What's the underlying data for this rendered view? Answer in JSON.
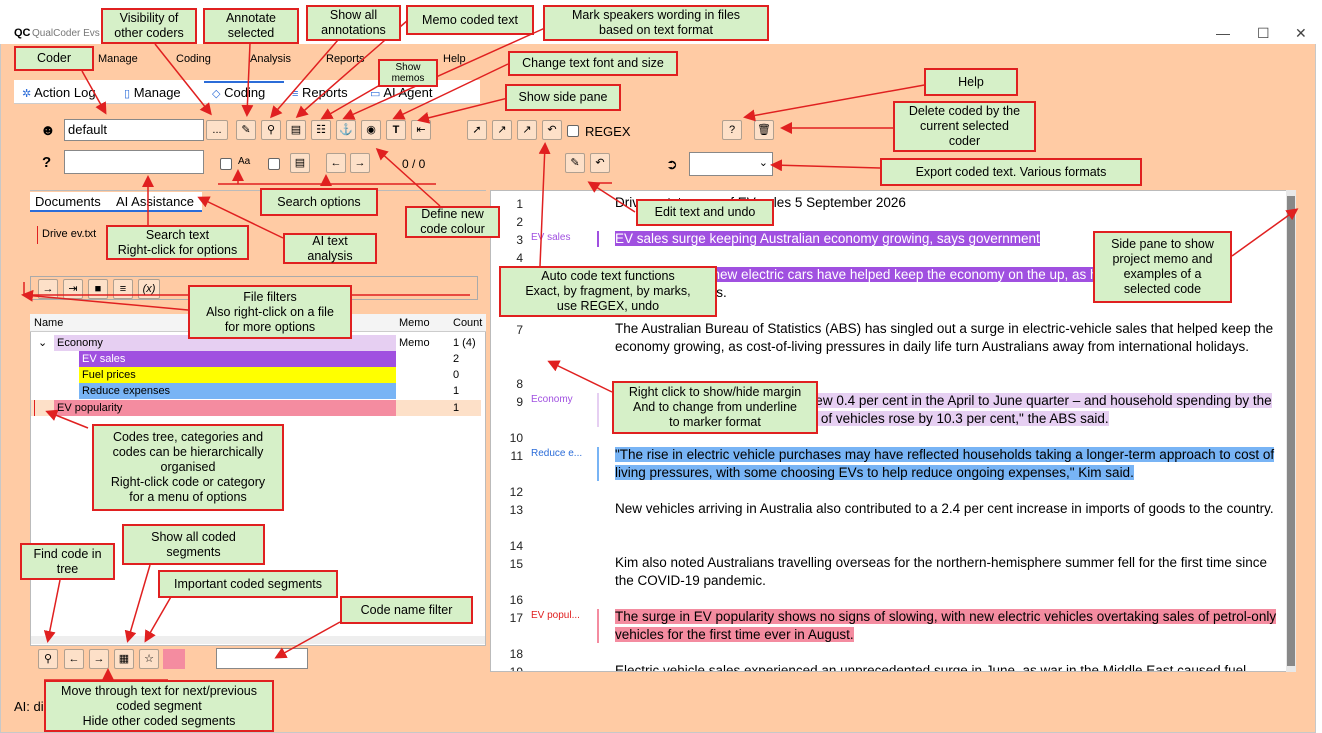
{
  "window": {
    "title": "QualCoder Evs",
    "logo": "QC",
    "controls": [
      "—",
      "☐",
      "✕"
    ]
  },
  "menu": [
    "Manage",
    "Coding",
    "Analysis",
    "Reports",
    "Help"
  ],
  "tabs": [
    {
      "label": "Action Log",
      "icon": "gear-icon"
    },
    {
      "label": "Manage",
      "icon": "document-icon"
    },
    {
      "label": "Coding",
      "icon": "tag-icon"
    },
    {
      "label": "Reports",
      "icon": "list-icon"
    },
    {
      "label": "AI Agent",
      "icon": "chat-icon"
    }
  ],
  "toolbar": {
    "coder_value": "default",
    "more_button": "...",
    "regex_label": "REGEX",
    "help_button": "?",
    "search_counter": "0 / 0",
    "search_case_label": "Aa",
    "search_placeholder": ""
  },
  "left_tabs": [
    "Documents",
    "AI Assistance"
  ],
  "file_list": [
    "Drive ev.txt"
  ],
  "file_filter_buttons": [
    "→",
    "⇥",
    "■",
    "≡",
    "(x)"
  ],
  "code_tree": {
    "headers": [
      "Name",
      "Memo",
      "Count"
    ],
    "rows": [
      {
        "name": "Economy",
        "memo": "Memo",
        "count": "1 (4)",
        "color": "#e6cff2",
        "level": 0,
        "expanded": true
      },
      {
        "name": "EV sales",
        "memo": "",
        "count": "2",
        "color": "#a050e0",
        "level": 1
      },
      {
        "name": "Fuel prices",
        "memo": "",
        "count": "0",
        "color": "#ffff00",
        "level": 1
      },
      {
        "name": "Reduce expenses",
        "memo": "",
        "count": "1",
        "color": "#78b4f5",
        "level": 1
      },
      {
        "name": "EV popularity",
        "memo": "",
        "count": "1",
        "color": "#f48ca0",
        "level": 0
      }
    ]
  },
  "status_bar": "AI: di",
  "document": {
    "lines": [
      {
        "n": "1",
        "text": "Drive ev.txt surge of EV sales 5 September 2026",
        "style": ""
      },
      {
        "n": "2",
        "text": "",
        "style": ""
      },
      {
        "n": "3",
        "text": "EV sales surge keeping Australian economy growing, says government",
        "style": "purple",
        "margin": "EV sales"
      },
      {
        "n": "4",
        "text": "Record sales of new electric cars have helped keep the economy on the up, as households cut back on",
        "style": "purple-partial"
      },
      {
        "n": "5",
        "text": "overseas holidays.",
        "style": ""
      },
      {
        "n": "7",
        "text": "The Australian Bureau of Statistics (ABS) has singled out a surge in electric-vehicle sales that helped keep the economy growing, as cost-of-living pressures in daily life turn Australians away from international holidays.",
        "style": ""
      },
      {
        "n": "8",
        "text": "",
        "style": ""
      },
      {
        "n": "9",
        "text": "Gross domestic product (GDP) grew 0.4 per cent in the April to June quarter – and household spending by the same amount – but the \"purchase of vehicles rose by 10.3 per cent,\" the ABS said.",
        "style": "violet",
        "margin": "Economy"
      },
      {
        "n": "10",
        "text": "",
        "style": ""
      },
      {
        "n": "11",
        "text": "\"The rise in electric vehicle purchases may have reflected households taking a longer-term approach to cost of living pressures, with some choosing EVs to help reduce ongoing expenses,\" Kim said.",
        "style": "blue",
        "margin": "Reduce e..."
      },
      {
        "n": "12",
        "text": "",
        "style": ""
      },
      {
        "n": "13",
        "text": "New vehicles arriving in Australia also contributed to a 2.4 per cent increase in imports of goods to the country.",
        "style": ""
      },
      {
        "n": "14",
        "text": "",
        "style": ""
      },
      {
        "n": "15",
        "text": "Kim also noted Australians travelling overseas for the northern-hemisphere summer fell for the first time since the COVID-19 pandemic.",
        "style": ""
      },
      {
        "n": "16",
        "text": "",
        "style": ""
      },
      {
        "n": "17",
        "text": "The surge in EV popularity shows no signs of slowing, with new electric vehicles overtaking sales of petrol-only vehicles for the first time ever in August.",
        "style": "pink",
        "margin": "EV popul..."
      },
      {
        "n": "18",
        "text": "",
        "style": ""
      },
      {
        "n": "19",
        "text": "Electric vehicle sales experienced an unprecedented surge in June, as war in the Middle East caused fuel",
        "style": ""
      }
    ]
  },
  "callouts": {
    "coder": "Coder",
    "visibility": "Visibility of\nother coders",
    "annotate": "Annotate\nselected",
    "show_annotations": "Show all\nannotations",
    "memo_coded": "Memo coded text",
    "mark_speakers": "Mark speakers wording in files\nbased on text format",
    "show_memos": "Show\nmemos",
    "change_font": "Change text font and size",
    "show_side_pane": "Show side pane",
    "help": "Help",
    "delete_coded": "Delete coded by the\ncurrent selected\ncoder",
    "export": "Export coded text. Various formats",
    "search_options": "Search options",
    "define_colour": "Define new\ncode colour",
    "edit_text": "Edit text and undo",
    "search_text": "Search text\nRight-click for options",
    "ai_text": "AI text\nanalysis",
    "auto_code": "Auto code text functions\nExact, by fragment, by marks,\nuse REGEX, undo",
    "side_pane_memo": "Side pane to show\nproject memo and\nexamples of a\nselected code",
    "file_filters": "File filters\nAlso right-click on a file\nfor more options",
    "right_click_margin": "Right click to show/hide margin\nAnd to change from underline\nto marker format",
    "codes_tree": "Codes tree, categories and\ncodes can be hierarchically\norganised\nRight-click code or category\nfor a menu of options",
    "show_all_coded": "Show all coded\nsegments",
    "find_code": "Find code in\ntree",
    "important_coded": "Important coded segments",
    "code_name_filter": "Code name filter",
    "move_through": "Move through text for next/previous\ncoded segment\nHide other coded segments"
  },
  "colors": {
    "window_bg": "#ffcba4",
    "callout_bg": "#d6f0c8",
    "callout_border": "#e02020",
    "accent": "#2b6cd8"
  }
}
